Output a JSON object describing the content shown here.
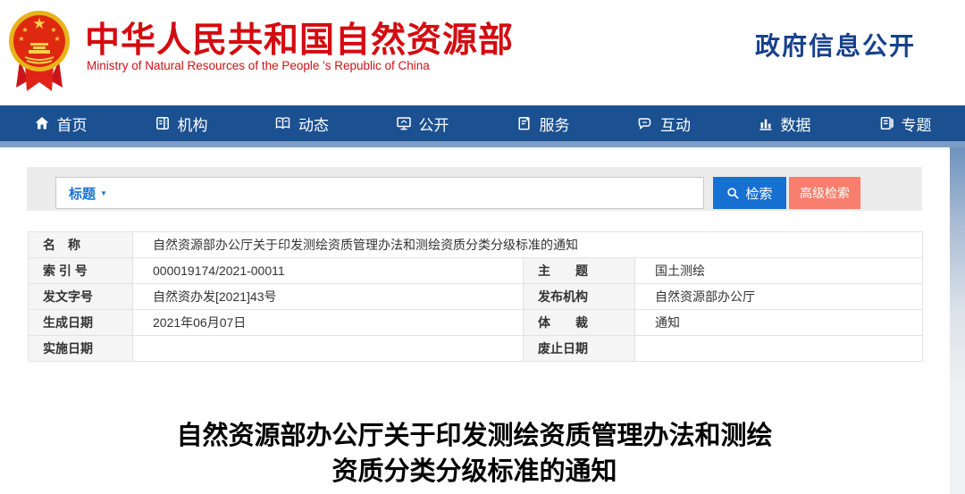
{
  "header": {
    "org_name_cn": "中华人民共和国自然资源部",
    "org_name_en": "Ministry of Natural Resources of the People 's Republic of China",
    "gov_info_title": "政府信息公开",
    "emblem_icon": "china-national-emblem"
  },
  "nav": {
    "items": [
      {
        "label": "首页",
        "icon": "home-icon"
      },
      {
        "label": "机构",
        "icon": "organization-icon"
      },
      {
        "label": "动态",
        "icon": "news-book-icon"
      },
      {
        "label": "公开",
        "icon": "monitor-icon"
      },
      {
        "label": "服务",
        "icon": "service-doc-icon"
      },
      {
        "label": "互动",
        "icon": "chat-bubble-icon"
      },
      {
        "label": "数据",
        "icon": "bar-chart-icon"
      },
      {
        "label": "专题",
        "icon": "journal-icon"
      }
    ]
  },
  "search": {
    "field_selector": "标题",
    "caret": "▼",
    "input_value": "",
    "search_button": "检索",
    "advanced_button": "高级检索",
    "search_icon": "magnifier-icon"
  },
  "doc_info": {
    "name_label": "名　称",
    "name_value": "自然资源部办公厅关于印发测绘资质管理办法和测绘资质分类分级标准的通知",
    "index_label": "索 引 号",
    "index_value": "000019174/2021-00011",
    "subject_label": "主　　题",
    "subject_value": "国土测绘",
    "doc_number_label": "发文字号",
    "doc_number_value": "自然资办发[2021]43号",
    "publisher_label": "发布机构",
    "publisher_value": "自然资源部办公厅",
    "create_date_label": "生成日期",
    "create_date_value": "2021年06月07日",
    "genre_label": "体　　裁",
    "genre_value": "通知",
    "impl_date_label": "实施日期",
    "impl_date_value": "",
    "repeal_date_label": "废止日期",
    "repeal_date_value": ""
  },
  "document": {
    "title_line1": "自然资源部办公厅关于印发测绘资质管理办法和测绘",
    "title_line2": "资质分类分级标准的通知"
  },
  "colors": {
    "brand_red": "#d40b10",
    "nav_blue": "#1b5091",
    "strip_blue": "#7e9dc6",
    "button_blue": "#1670d2",
    "button_salmon": "#f87e6d",
    "gov_navy": "#17418e",
    "panel_gray": "#ececec"
  }
}
